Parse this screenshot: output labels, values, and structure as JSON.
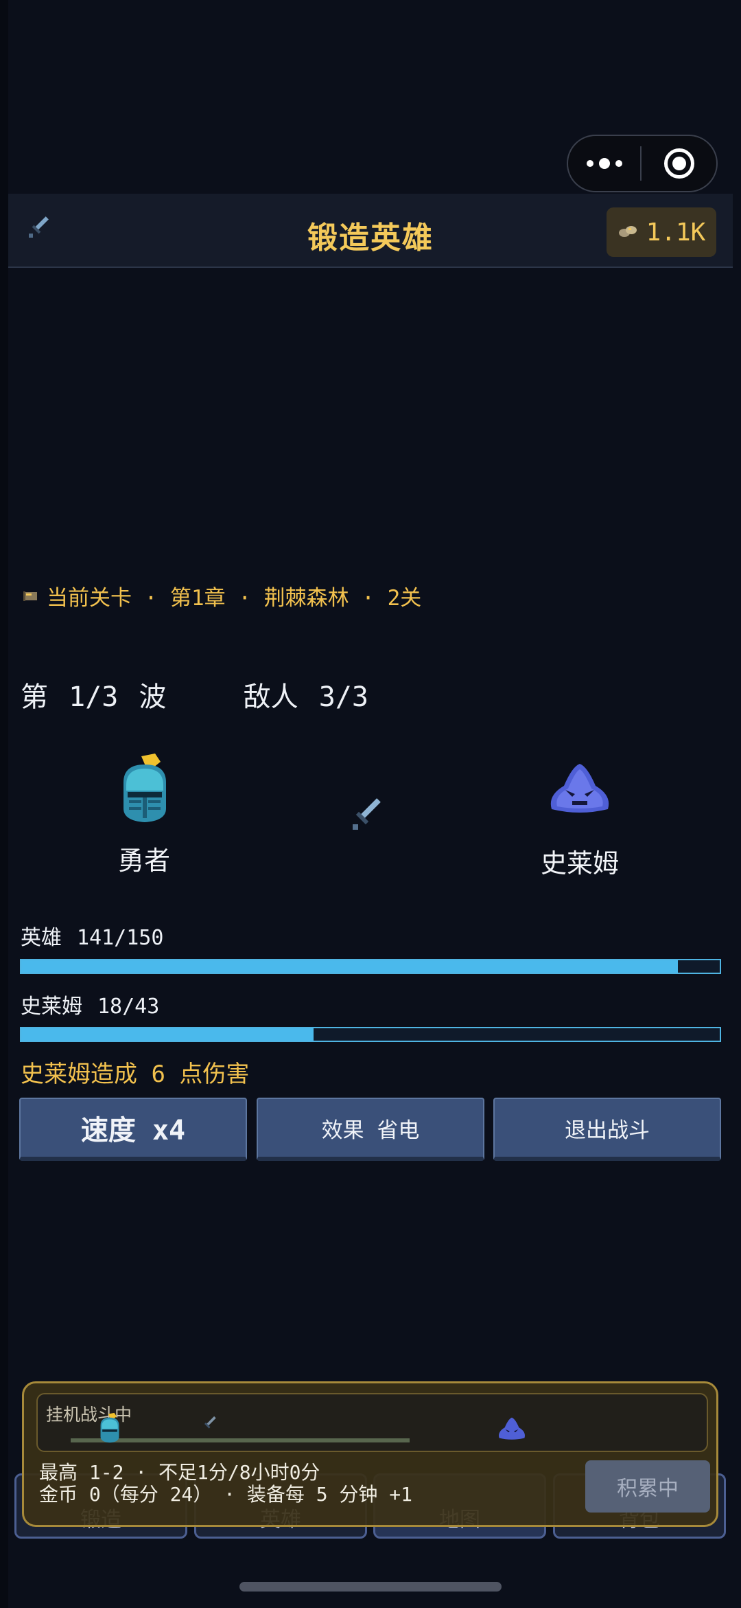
{
  "header": {
    "title": "锻造英雄",
    "gold": "1.1K",
    "sword_icon": "sword-icon",
    "gold_icon": "gold-ore-icon"
  },
  "capsule": {
    "menu_icon": "more-dots-icon",
    "close_icon": "target-circle-icon"
  },
  "stage": {
    "icon": "map-scroll-icon",
    "text": "当前关卡 · 第1章 · 荆棘森林 · 2关"
  },
  "battle": {
    "wave_text": "第 1/3 波",
    "enemy_count_text": "敌人 3/3",
    "hero_name": "勇者",
    "enemy_name": "史莱姆",
    "hero_hp": {
      "label": "英雄",
      "value": "141/150",
      "current": 141,
      "max": 150
    },
    "enemy_hp": {
      "label": "史莱姆",
      "value": "18/43",
      "current": 18,
      "max": 43
    },
    "damage_text": "史莱姆造成 6 点伤害"
  },
  "controls": {
    "speed_label": "速度 x4",
    "effect_label": "效果 省电",
    "exit_label": "退出战斗"
  },
  "nav": {
    "tabs": [
      {
        "label": "锻造"
      },
      {
        "label": "英雄"
      },
      {
        "label": "地图"
      },
      {
        "label": "背包"
      }
    ]
  },
  "idle": {
    "status": "挂机战斗中",
    "line1": "最高 1-2 · 不足1分/8小时0分",
    "line2": "金币 0（每分 24） · 装备每 5 分钟 +1",
    "claim_label": "积累中"
  },
  "colors": {
    "accent_gold": "#f4c95a",
    "hp_bar": "#4ab9ec",
    "button_bg": "#3a5079",
    "overlay_border": "#a78a3a"
  }
}
